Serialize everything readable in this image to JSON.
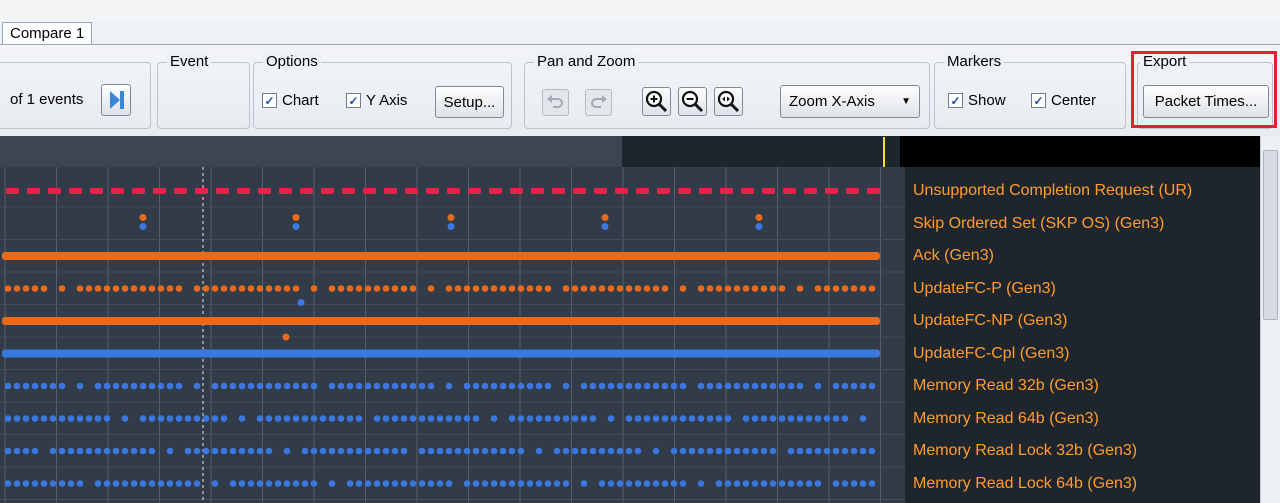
{
  "tabs": [
    "Compare 1"
  ],
  "toolbar": {
    "nav": {
      "events_text": "of 1 events",
      "next_icon": "next-end-icon"
    },
    "event": {
      "title": "Event"
    },
    "options": {
      "title": "Options",
      "chart_label": "Chart",
      "chart_checked": true,
      "yaxis_label": "Y Axis",
      "yaxis_checked": true,
      "setup_label": "Setup..."
    },
    "pan_zoom": {
      "title": "Pan and Zoom",
      "icons": [
        "undo-icon",
        "redo-icon",
        "zoom-in-icon",
        "zoom-out-icon",
        "zoom-fit-icon"
      ],
      "zoom_axis_value": "Zoom X-Axis"
    },
    "markers": {
      "title": "Markers",
      "show_label": "Show",
      "show_checked": true,
      "center_label": "Center",
      "center_checked": true
    },
    "export": {
      "title": "Export",
      "button_label": "Packet Times..."
    }
  },
  "chart": {
    "label_color": "#ff9c2e",
    "rows": [
      {
        "label": "Unsupported Completion Request (UR)",
        "color": "#e8234a",
        "pattern": "dash"
      },
      {
        "label": "Skip Ordered Set (SKP OS) (Gen3)",
        "color": "#ea6a1c",
        "pattern": "pair"
      },
      {
        "label": "Ack (Gen3)",
        "color": "#ea6a1c",
        "pattern": "solid"
      },
      {
        "label": "UpdateFC-P (Gen3)",
        "color": "#ea6a1c",
        "pattern": "dots"
      },
      {
        "label": "UpdateFC-NP (Gen3)",
        "color": "#ea6a1c",
        "pattern": "solid"
      },
      {
        "label": "UpdateFC-Cpl (Gen3)",
        "color": "#3a78e0",
        "pattern": "solid"
      },
      {
        "label": "Memory Read 32b (Gen3)",
        "color": "#3a78e0",
        "pattern": "dots"
      },
      {
        "label": "Memory Read 64b (Gen3)",
        "color": "#3a78e0",
        "pattern": "dots"
      },
      {
        "label": "Memory Read Lock 32b (Gen3)",
        "color": "#3a78e0",
        "pattern": "dots"
      },
      {
        "label": "Memory Read Lock 64b (Gen3)",
        "color": "#3a78e0",
        "pattern": "dots"
      }
    ]
  }
}
